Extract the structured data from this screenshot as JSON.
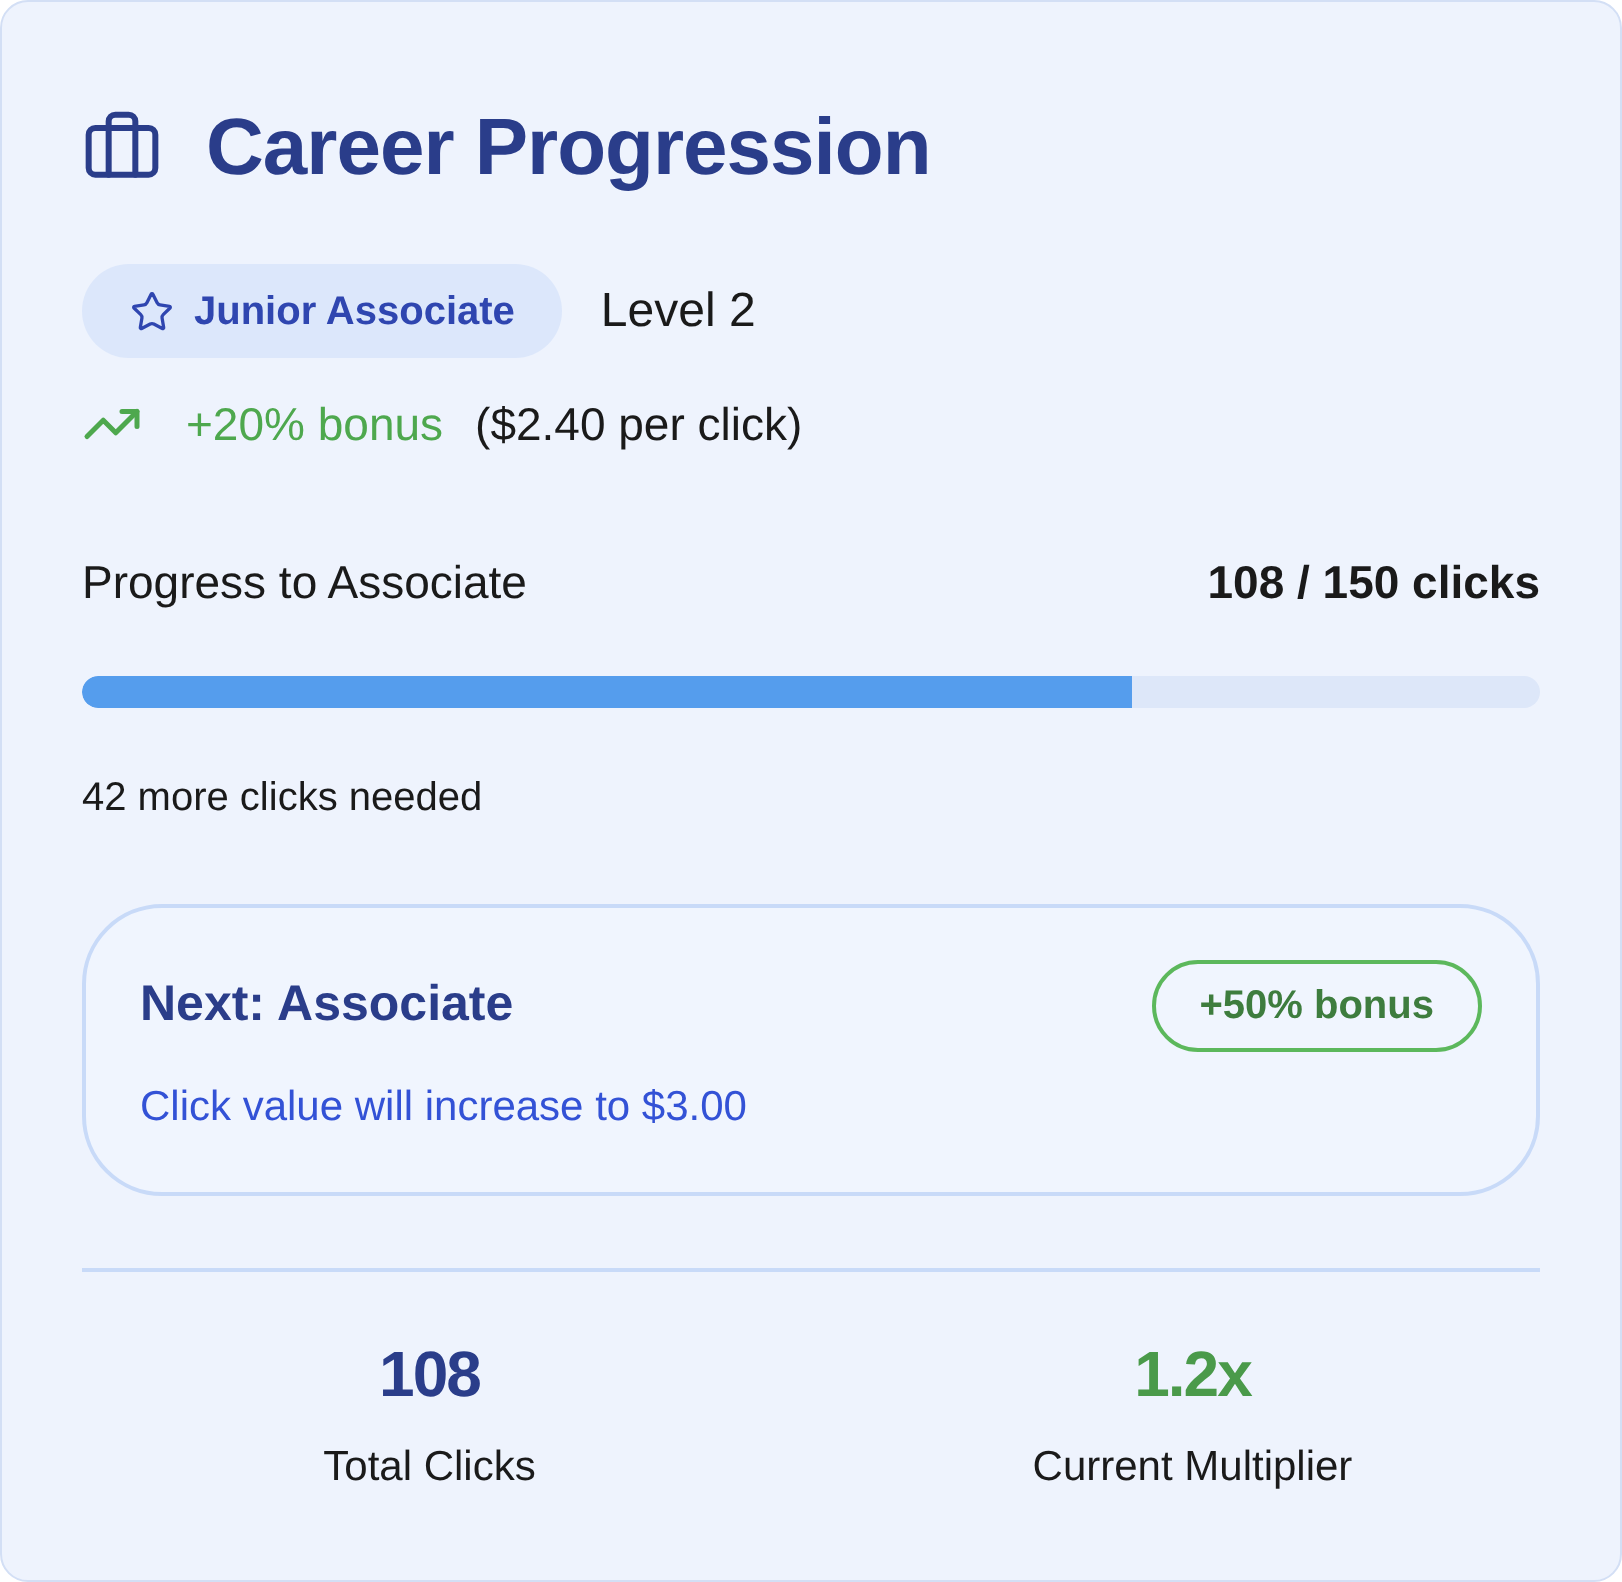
{
  "header": {
    "title": "Career Progression"
  },
  "rank": {
    "title": "Junior Associate",
    "level": "Level 2"
  },
  "bonus": {
    "value": "+20% bonus",
    "per_click": "($2.40 per click)"
  },
  "progress": {
    "label": "Progress to Associate",
    "reading": "108 / 150 clicks",
    "level": 0.72,
    "remaining": "42 more clicks needed"
  },
  "next_rank": {
    "title": "Next: Associate",
    "badge": "+50% bonus",
    "description": "Click value will increase to $3.00"
  },
  "stats": [
    {
      "kind": "count",
      "value": "108",
      "label": "Total Clicks"
    },
    {
      "kind": "multiplier",
      "value": "1.2x",
      "label": "Current Multiplier"
    }
  ]
}
